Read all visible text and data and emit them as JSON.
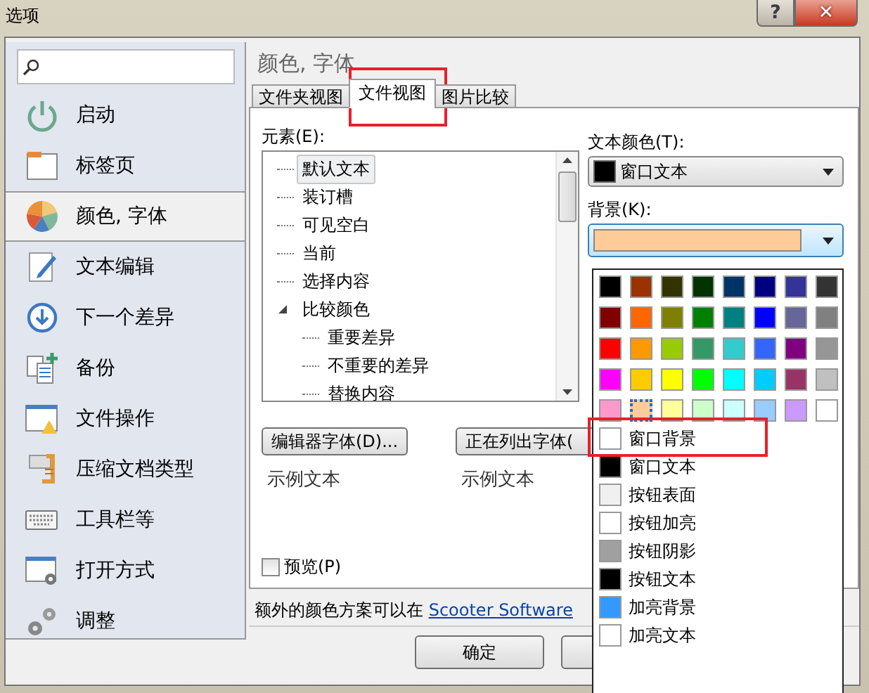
{
  "window": {
    "title": "选项",
    "help": "?",
    "close": "✕"
  },
  "sidebar": {
    "items": [
      {
        "label": "启动",
        "selected": false
      },
      {
        "label": "标签页",
        "selected": false
      },
      {
        "label": "颜色, 字体",
        "selected": true
      },
      {
        "label": "文本编辑",
        "selected": false
      },
      {
        "label": "下一个差异",
        "selected": false
      },
      {
        "label": "备份",
        "selected": false
      },
      {
        "label": "文件操作",
        "selected": false
      },
      {
        "label": "压缩文档类型",
        "selected": false
      },
      {
        "label": "工具栏等",
        "selected": false
      },
      {
        "label": "打开方式",
        "selected": false
      },
      {
        "label": "调整",
        "selected": false
      }
    ]
  },
  "heading": "颜色, 字体",
  "tabs": [
    {
      "label": "文件夹视图",
      "selected": false
    },
    {
      "label": "文件视图",
      "selected": true
    },
    {
      "label": "图片比较",
      "selected": false
    }
  ],
  "elements_label": "元素(E):",
  "tree": [
    {
      "label": "默认文本",
      "selected": true
    },
    {
      "label": "装订槽",
      "selected": false
    },
    {
      "label": "可见空白",
      "selected": false
    },
    {
      "label": "当前",
      "selected": false
    },
    {
      "label": "选择内容",
      "selected": false
    },
    {
      "label": "比较颜色",
      "selected": false,
      "expanded": true,
      "children": [
        {
          "label": "重要差异",
          "selected": false
        },
        {
          "label": "不重要的差异",
          "selected": false
        },
        {
          "label": "替换内容",
          "selected": false
        }
      ]
    }
  ],
  "text_color": {
    "label": "文本颜色(T):",
    "value": "窗口文本",
    "color": "#000000"
  },
  "background": {
    "label": "背景(K):",
    "color": "#ffcc99"
  },
  "editor_font_button": "编辑器字体(D)...",
  "editor_sample": "示例文本",
  "listing_font_button": "正在列出字体(",
  "listing_sample": "示例文本",
  "preview": {
    "label": "预览(P)",
    "checked": false
  },
  "footer": {
    "text": "额外的颜色方案可以在 ",
    "link": "Scooter Software"
  },
  "ok_button": "确定",
  "palette": [
    {
      "color": "#000000",
      "selected": false
    },
    {
      "color": "#993300",
      "selected": false
    },
    {
      "color": "#333300",
      "selected": false
    },
    {
      "color": "#003300",
      "selected": false
    },
    {
      "color": "#003366",
      "selected": false
    },
    {
      "color": "#000080",
      "selected": false
    },
    {
      "color": "#333399",
      "selected": false
    },
    {
      "color": "#333333",
      "selected": false
    },
    {
      "color": "#800000",
      "selected": false
    },
    {
      "color": "#ff6600",
      "selected": false
    },
    {
      "color": "#808000",
      "selected": false
    },
    {
      "color": "#008000",
      "selected": false
    },
    {
      "color": "#008080",
      "selected": false
    },
    {
      "color": "#0000ff",
      "selected": false
    },
    {
      "color": "#666699",
      "selected": false
    },
    {
      "color": "#808080",
      "selected": false
    },
    {
      "color": "#ff0000",
      "selected": false
    },
    {
      "color": "#ff9900",
      "selected": false
    },
    {
      "color": "#99cc00",
      "selected": false
    },
    {
      "color": "#339966",
      "selected": false
    },
    {
      "color": "#33cccc",
      "selected": false
    },
    {
      "color": "#3366ff",
      "selected": false
    },
    {
      "color": "#800080",
      "selected": false
    },
    {
      "color": "#969696",
      "selected": false
    },
    {
      "color": "#ff00ff",
      "selected": false
    },
    {
      "color": "#ffcc00",
      "selected": false
    },
    {
      "color": "#ffff00",
      "selected": false
    },
    {
      "color": "#00ff00",
      "selected": false
    },
    {
      "color": "#00ffff",
      "selected": false
    },
    {
      "color": "#00ccff",
      "selected": false
    },
    {
      "color": "#993366",
      "selected": false
    },
    {
      "color": "#c0c0c0",
      "selected": false
    },
    {
      "color": "#ff99cc",
      "selected": false
    },
    {
      "color": "#ffcc99",
      "selected": true
    },
    {
      "color": "#ffff99",
      "selected": false
    },
    {
      "color": "#ccffcc",
      "selected": false
    },
    {
      "color": "#ccffff",
      "selected": false
    },
    {
      "color": "#99ccff",
      "selected": false
    },
    {
      "color": "#cc99ff",
      "selected": false
    },
    {
      "color": "#ffffff",
      "selected": false
    }
  ],
  "system_colors": [
    {
      "label": "窗口背景",
      "color": "#ffffff"
    },
    {
      "label": "窗口文本",
      "color": "#000000"
    },
    {
      "label": "按钮表面",
      "color": "#f0f0f0"
    },
    {
      "label": "按钮加亮",
      "color": "#ffffff"
    },
    {
      "label": "按钮阴影",
      "color": "#a0a0a0"
    },
    {
      "label": "按钮文本",
      "color": "#000000"
    },
    {
      "label": "加亮背景",
      "color": "#3399ff"
    },
    {
      "label": "加亮文本",
      "color": "#ffffff"
    }
  ]
}
